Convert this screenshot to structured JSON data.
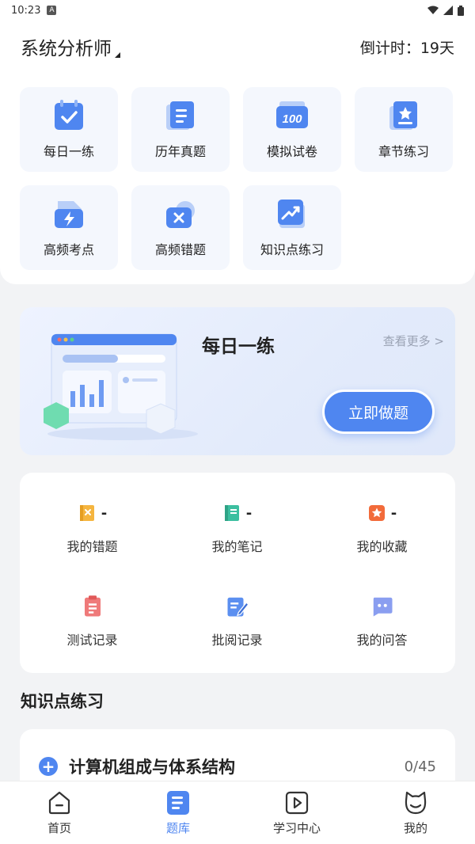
{
  "status_bar": {
    "time": "10:23"
  },
  "header": {
    "title": "系统分析师",
    "countdown": "倒计时：19天"
  },
  "grid": [
    {
      "label": "每日一练",
      "icon": "calendar-check-icon"
    },
    {
      "label": "历年真题",
      "icon": "document-icon"
    },
    {
      "label": "模拟试卷",
      "icon": "score-100-icon"
    },
    {
      "label": "章节练习",
      "icon": "star-book-icon"
    },
    {
      "label": "高频考点",
      "icon": "lightning-folder-icon"
    },
    {
      "label": "高频错题",
      "icon": "wrong-folder-icon"
    },
    {
      "label": "知识点练习",
      "icon": "trend-icon"
    }
  ],
  "banner": {
    "title": "每日一练",
    "more": "查看更多 >",
    "button": "立即做题"
  },
  "records": [
    {
      "label": "我的错题",
      "count": "-",
      "icon": "wrong-book-icon",
      "color": "#f5b53f"
    },
    {
      "label": "我的笔记",
      "count": "-",
      "icon": "notebook-icon",
      "color": "#3cbfa0"
    },
    {
      "label": "我的收藏",
      "count": "-",
      "icon": "star-icon",
      "color": "#f26b3a"
    },
    {
      "label": "测试记录",
      "icon": "clipboard-icon",
      "color": "#ef7a7a"
    },
    {
      "label": "批阅记录",
      "icon": "edit-doc-icon",
      "color": "#5b8ff0"
    },
    {
      "label": "我的问答",
      "icon": "chat-icon",
      "color": "#8a9ef0"
    }
  ],
  "knowledge": {
    "section_title": "知识点练习",
    "items": [
      {
        "name": "计算机组成与体系结构",
        "progress": "0/45"
      }
    ]
  },
  "tabs": [
    {
      "label": "首页",
      "icon": "home-icon",
      "active": false
    },
    {
      "label": "题库",
      "icon": "question-bank-icon",
      "active": true
    },
    {
      "label": "学习中心",
      "icon": "play-icon",
      "active": false
    },
    {
      "label": "我的",
      "icon": "profile-cat-icon",
      "active": false
    }
  ],
  "colors": {
    "accent": "#4f86f0",
    "tile_bg": "#f4f7fd",
    "page_bg": "#f2f3f5"
  }
}
